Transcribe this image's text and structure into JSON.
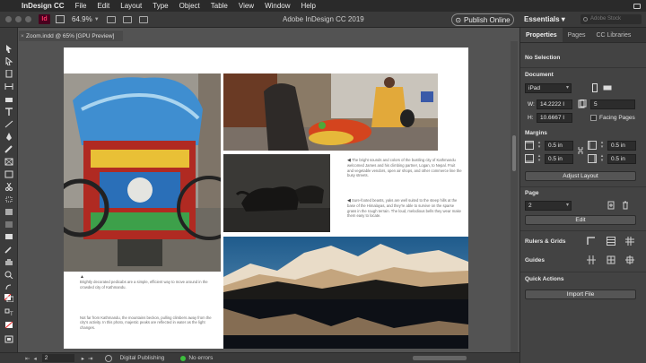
{
  "menubar": {
    "app_name": "InDesign CC",
    "items": [
      "File",
      "Edit",
      "Layout",
      "Type",
      "Object",
      "Table",
      "View",
      "Window",
      "Help"
    ]
  },
  "appbar": {
    "zoom": "64.9%",
    "window_title": "Adobe InDesign CC 2019",
    "publish_label": "Publish Online",
    "workspace_label": "Essentials",
    "search_placeholder": "Adobe Stock"
  },
  "document_tab": {
    "label": "Zoom.indd @ 65% [GPU Preview]"
  },
  "page_captions": {
    "market": "The bright sounds and colors of the bustling city of Kathmandu welcomed James and his climbing partner, Logan, to Nepal. Fruit and vegetable vendors, open air shops, and other commerce line the busy streets.",
    "yaks": "Sure-footed beasts, yaks are well suited to the steep hills at the base of the Himalayas, and they're able to survive on the sparse grass in the rough terrain. The loud, melodious bells they wear make them easy to locate.",
    "pedicab": "Brightly decorated pedicabs are a simple, efficient way to move around in the crowded city of Kathmandu.",
    "mountains": "Not far from Kathmandu, the mountains beckon, pulling climbers away from the city's activity. In this photo, majestic peaks are reflected in water as the light changes."
  },
  "status": {
    "page_value": "2",
    "preflight_profile": "Digital Publishing",
    "errors": "No errors"
  },
  "panel": {
    "tabs": [
      "Properties",
      "Pages",
      "CC Libraries"
    ],
    "selection": "No Selection",
    "document_heading": "Document",
    "preset": "iPad",
    "width_label": "W:",
    "width_value": "14.2222 I",
    "height_label": "H:",
    "height_value": "10.6667 I",
    "pages_count": "5",
    "facing_pages_label": "Facing Pages",
    "margins_heading": "Margins",
    "margin_top": "0.5 in",
    "margin_bottom": "0.5 in",
    "margin_left": "0.5 in",
    "margin_right": "0.5 in",
    "adjust_layout_label": "Adjust Layout",
    "page_heading": "Page",
    "page_value": "2",
    "edit_label": "Edit",
    "rulers_heading": "Rulers & Grids",
    "guides_heading": "Guides",
    "quick_actions_heading": "Quick Actions",
    "import_file_label": "Import File"
  }
}
